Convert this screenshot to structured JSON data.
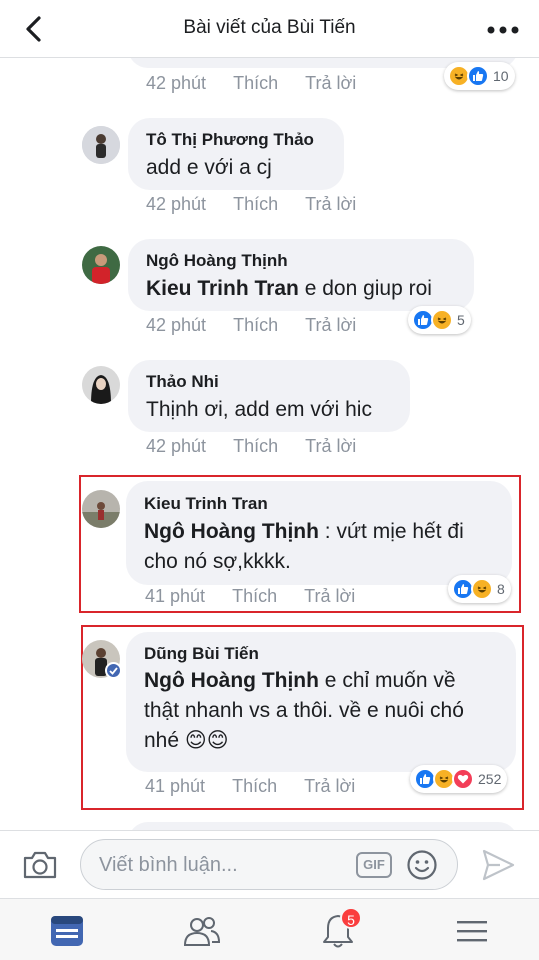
{
  "header": {
    "title": "Bài viết của Bùi Tiến"
  },
  "comments": [
    {
      "author": "",
      "time": "42 phút",
      "like": "Thích",
      "reply": "Trả lời",
      "reactions": [
        "haha-icon",
        "like-icon"
      ],
      "reaction_count": "10"
    },
    {
      "author": "Tô Thị Phương Thảo",
      "mention": "",
      "text": "add e với a cj",
      "time": "42 phút",
      "like": "Thích",
      "reply": "Trả lời"
    },
    {
      "author": "Ngô Hoàng Thịnh",
      "mention": "Kieu Trinh Tran",
      "text": " e don giup roi",
      "time": "42 phút",
      "like": "Thích",
      "reply": "Trả lời",
      "reactions": [
        "like-icon",
        "haha-icon"
      ],
      "reaction_count": "5"
    },
    {
      "author": "Thảo Nhi",
      "mention": "",
      "text": "Thịnh ơi, add em với hic",
      "time": "42 phút",
      "like": "Thích",
      "reply": "Trả lời"
    },
    {
      "author": "Kieu Trinh Tran",
      "mention": "Ngô Hoàng Thịnh",
      "text_line1": " : vứt mịe hết đi",
      "text_line2": "cho nó sợ,kkkk.",
      "time": "41 phút",
      "like": "Thích",
      "reply": "Trả lời",
      "reactions": [
        "like-icon",
        "haha-icon"
      ],
      "reaction_count": "8"
    },
    {
      "author": "Dũng Bùi Tiến",
      "mention": "Ngô Hoàng Thịnh",
      "text_line1": "  e chỉ muốn về",
      "text_line2": "thật nhanh vs a thôi. về e nuôi chó",
      "text_line3": "nhé",
      "emoji": "😊😊",
      "time": "41 phút",
      "like": "Thích",
      "reply": "Trả lời",
      "reactions": [
        "like-icon",
        "haha-icon",
        "love-icon"
      ],
      "reaction_count": "252",
      "verified": true
    }
  ],
  "composer": {
    "placeholder": "Viết bình luận...",
    "gif_label": "GIF"
  },
  "tabbar": {
    "notification_count": "5"
  },
  "colors": {
    "accent": "#4267b2",
    "highlight_border": "#d9252b",
    "bubble": "#f1f2f6",
    "meta_text": "#8d949e"
  }
}
